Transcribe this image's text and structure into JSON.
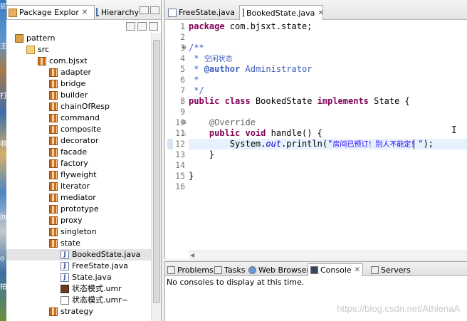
{
  "desktop_strip": {
    "glyphs": [
      "拡",
      "主",
      "打",
      "收",
      "回",
      "ο",
      "拍"
    ]
  },
  "left_panel": {
    "tabs": [
      {
        "label": "Package Explor",
        "close": "✕",
        "active": true
      },
      {
        "label": "Hierarchy",
        "active": false
      }
    ],
    "tree": [
      {
        "label": "pattern",
        "icon": "project-icon",
        "indent": 0
      },
      {
        "label": "src",
        "icon": "source-folder-icon",
        "indent": 1
      },
      {
        "label": "com.bjsxt",
        "icon": "package-icon",
        "indent": 2
      },
      {
        "label": "adapter",
        "icon": "package-icon",
        "indent": 3
      },
      {
        "label": "bridge",
        "icon": "package-icon",
        "indent": 3
      },
      {
        "label": "builder",
        "icon": "package-icon",
        "indent": 3
      },
      {
        "label": "chainOfResp",
        "icon": "package-icon",
        "indent": 3
      },
      {
        "label": "command",
        "icon": "package-icon",
        "indent": 3
      },
      {
        "label": "composite",
        "icon": "package-icon",
        "indent": 3
      },
      {
        "label": "decorator",
        "icon": "package-icon",
        "indent": 3
      },
      {
        "label": "facade",
        "icon": "package-icon",
        "indent": 3
      },
      {
        "label": "factory",
        "icon": "package-icon",
        "indent": 3
      },
      {
        "label": "flyweight",
        "icon": "package-icon",
        "indent": 3
      },
      {
        "label": "iterator",
        "icon": "package-icon",
        "indent": 3
      },
      {
        "label": "mediator",
        "icon": "package-icon",
        "indent": 3
      },
      {
        "label": "prototype",
        "icon": "package-icon",
        "indent": 3
      },
      {
        "label": "proxy",
        "icon": "package-icon",
        "indent": 3
      },
      {
        "label": "singleton",
        "icon": "package-icon",
        "indent": 3
      },
      {
        "label": "state",
        "icon": "package-icon",
        "indent": 3
      },
      {
        "label": "BookedState.java",
        "icon": "java-file-icon",
        "indent": 4,
        "selected": true
      },
      {
        "label": "FreeState.java",
        "icon": "java-file-icon",
        "indent": 4
      },
      {
        "label": "State.java",
        "icon": "java-file-icon",
        "indent": 4
      },
      {
        "label": "状态模式.umr",
        "icon": "umr-file-icon",
        "indent": 4
      },
      {
        "label": "状态模式.umr~",
        "icon": "umr-backup-icon",
        "indent": 4
      },
      {
        "label": "strategy",
        "icon": "package-icon",
        "indent": 3
      }
    ]
  },
  "editor": {
    "tabs": [
      {
        "label": "FreeState.java",
        "active": false
      },
      {
        "label": "BookedState.java",
        "close": "✕",
        "active": true
      }
    ],
    "lines": [
      {
        "n": "1",
        "html": "<span class=\"kw\">package</span> com.bjsxt.state;"
      },
      {
        "n": "2",
        "html": ""
      },
      {
        "n": "3",
        "html": "<span class=\"cm\">/**</span>",
        "fold": "⊖"
      },
      {
        "n": "4",
        "html": "<span class=\"cm\"> * <span class=\"cjk\">空闲状态</span></span>"
      },
      {
        "n": "5",
        "html": "<span class=\"cm\"> * <b>@author</b> Administrator</span>"
      },
      {
        "n": "6",
        "html": "<span class=\"cm\"> *</span>"
      },
      {
        "n": "7",
        "html": "<span class=\"cm\"> */</span>"
      },
      {
        "n": "8",
        "html": "<span class=\"kw\">public</span> <span class=\"kw\">class</span> BookedState <span class=\"kw\">implements</span> State {"
      },
      {
        "n": "9",
        "html": ""
      },
      {
        "n": "10",
        "html": "    <span class=\"an\">@Override</span>",
        "fold": "⊖"
      },
      {
        "n": "11",
        "html": "    <span class=\"kw\">public</span> <span class=\"kw\">void</span> handle() {",
        "mark": "△"
      },
      {
        "n": "12",
        "html": "        System.<span class=\"it\">out</span>.println(<span class=\"st\">\"<span class=\"cjk\">房间已预订！别人不能定！</span>\"</span>);",
        "current": true
      },
      {
        "n": "13",
        "html": "    }"
      },
      {
        "n": "14",
        "html": ""
      },
      {
        "n": "15",
        "html": "}"
      },
      {
        "n": "16",
        "html": ""
      }
    ]
  },
  "bottom_panel": {
    "tabs": [
      {
        "label": "Problems",
        "icon": "problems-icon"
      },
      {
        "label": "Tasks",
        "icon": "tasks-icon"
      },
      {
        "label": "Web Browser",
        "icon": "web-browser-icon"
      },
      {
        "label": "Console",
        "icon": "console-icon",
        "active": true,
        "close": "✕"
      },
      {
        "label": "Servers",
        "icon": "servers-icon"
      }
    ],
    "message": "No consoles to display at this time.",
    "watermark": "https://blog.csdn.net/AthlenaA"
  },
  "colors": {
    "keyword": "#7f0055",
    "comment": "#3f5fbf",
    "string": "#2a00ff",
    "annotation": "#646464",
    "current_line": "#e8f2fe"
  }
}
